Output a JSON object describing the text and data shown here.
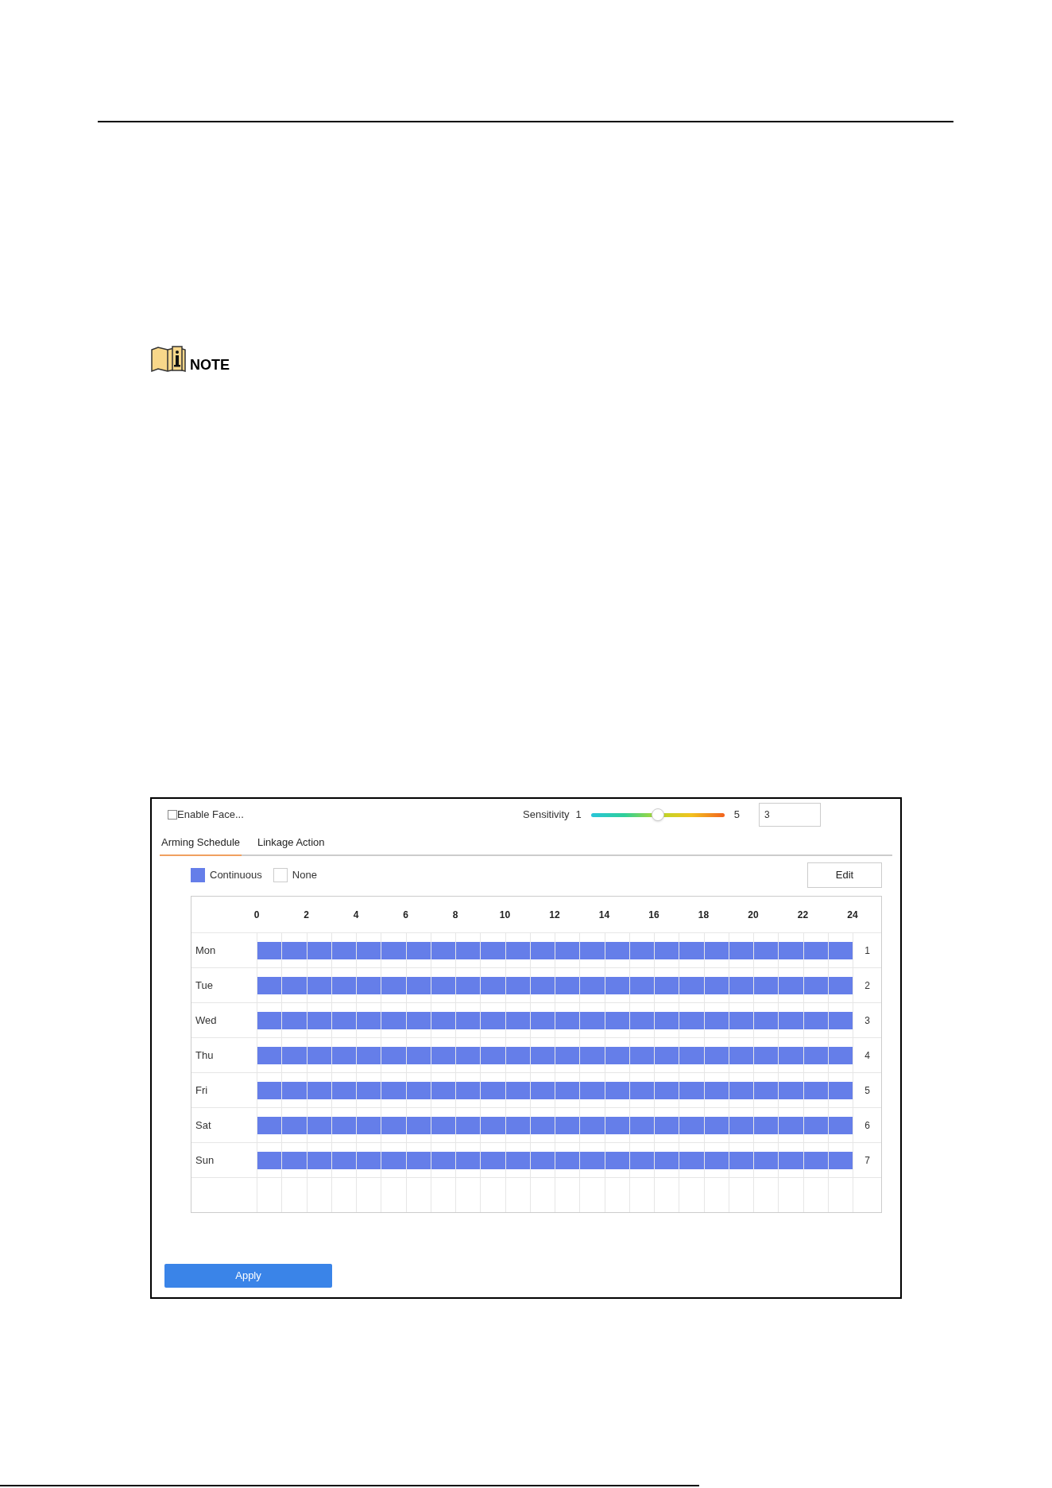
{
  "note": {
    "label": "NOTE"
  },
  "panel": {
    "enable": {
      "label": "Enable Face...",
      "checked": false
    },
    "sensitivity": {
      "label": "Sensitivity",
      "min": "1",
      "max": "5",
      "level": 0.5,
      "value": "3"
    },
    "tabs": [
      {
        "label": "Arming Schedule",
        "selected": true
      },
      {
        "label": "Linkage Action",
        "selected": false
      }
    ],
    "legend": [
      {
        "label": "Continuous",
        "kind": "continuous",
        "color": "#657ee9"
      },
      {
        "label": "None",
        "kind": "none",
        "color": "#ffffff"
      }
    ],
    "edit_button": "Edit",
    "schedule": {
      "hours": [
        "0",
        "2",
        "4",
        "6",
        "8",
        "10",
        "12",
        "14",
        "16",
        "18",
        "20",
        "22",
        "24"
      ],
      "days": [
        {
          "day": "Mon",
          "number": "1",
          "kind": "continuous"
        },
        {
          "day": "Tue",
          "number": "2",
          "kind": "continuous"
        },
        {
          "day": "Wed",
          "number": "3",
          "kind": "continuous"
        },
        {
          "day": "Thu",
          "number": "4",
          "kind": "continuous"
        },
        {
          "day": "Fri",
          "number": "5",
          "kind": "continuous"
        },
        {
          "day": "Sat",
          "number": "6",
          "kind": "continuous"
        },
        {
          "day": "Sun",
          "number": "7",
          "kind": "continuous"
        }
      ]
    },
    "apply_button": "Apply"
  }
}
